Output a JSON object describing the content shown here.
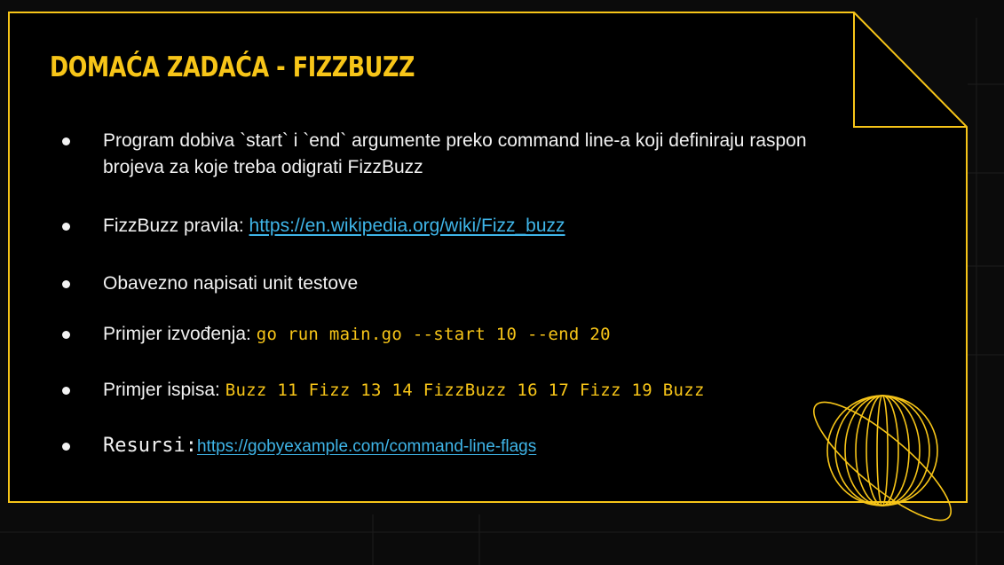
{
  "slide": {
    "title": "DOMAĆA ZADAĆA - FIZZBUZZ",
    "accent_color": "#f7c518",
    "link_color": "#3fb5e8",
    "background_color": "#0b0b0b",
    "bullets": [
      {
        "text": "Program dobiva `start` i `end` argumente preko command line-a koji definiraju raspon brojeva za koje treba odigrati FizzBuzz"
      },
      {
        "label": "FizzBuzz pravila: ",
        "link": "https://en.wikipedia.org/wiki/Fizz_buzz"
      },
      {
        "text": "Obavezno napisati unit testove"
      },
      {
        "label": "Primjer izvođenja: ",
        "code": "go run main.go --start 10 --end 20"
      },
      {
        "label": "Primjer ispisa: ",
        "code": "Buzz 11 Fizz 13 14 FizzBuzz 16 17 Fizz 19 Buzz"
      },
      {
        "label": "Resursi:",
        "link": "https://gobyexample.com/command-line-flags"
      }
    ],
    "decoration_icon": "planet-globe-icon"
  }
}
